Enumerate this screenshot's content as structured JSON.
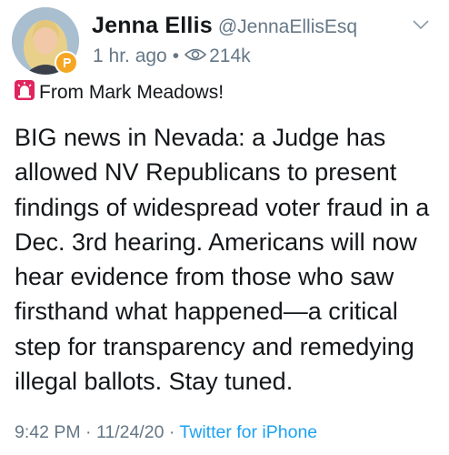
{
  "author": {
    "display_name": "Jenna Ellis",
    "handle": "@JennaEllisEsq"
  },
  "meta": {
    "time_ago": "1 hr. ago",
    "separator": "•",
    "views": "214k"
  },
  "social_context": "From Mark Meadows!",
  "tweet_lines": [
    "BIG news in Nevada: a Judge has",
    "allowed NV Republicans to present",
    "findings of widespread voter fraud in a",
    "Dec. 3rd hearing. Americans will now",
    "hear evidence from those who saw",
    "firsthand what happened—a critical",
    "step for transparency and remedying",
    "illegal ballots. Stay tuned."
  ],
  "footer": {
    "timestamp": "9:42 PM · 11/24/20",
    "separator": " · ",
    "source": "Twitter for iPhone"
  },
  "colors": {
    "text": "#14171a",
    "secondary": "#657786",
    "link": "#1da1f2",
    "badge": "#f5a623",
    "siren": "#e0245e"
  }
}
